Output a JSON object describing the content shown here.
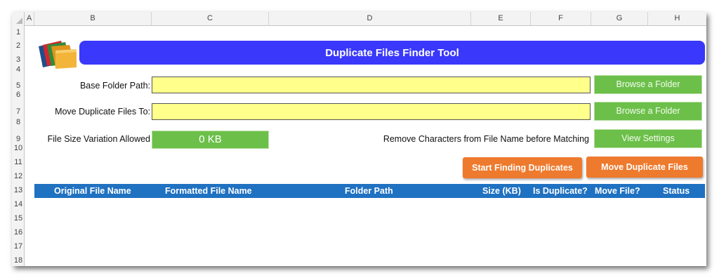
{
  "columns": [
    "A",
    "B",
    "C",
    "D",
    "E",
    "F",
    "G",
    "H"
  ],
  "rows": [
    "1",
    "2",
    "3",
    "4",
    "5",
    "6",
    "7",
    "8",
    "9",
    "10",
    "11",
    "12",
    "13",
    "14",
    "15",
    "16",
    "17",
    "18"
  ],
  "title": "Duplicate Files Finder Tool",
  "base_folder": {
    "label": "Base Folder Path:",
    "value": "",
    "button": "Browse a Folder"
  },
  "move_to": {
    "label": "Move Duplicate Files To:",
    "value": "",
    "button": "Browse a Folder"
  },
  "size_variation": {
    "label": "File Size Variation Allowed",
    "value": "0 KB"
  },
  "remove_chars": {
    "label": "Remove Characters from File Name before Matching",
    "button": "View Settings"
  },
  "actions": {
    "start": "Start Finding Duplicates",
    "move": "Move Duplicate Files"
  },
  "table_headers": [
    "Original File Name",
    "Formatted File Name",
    "Folder Path",
    "Size (KB)",
    "Is Duplicate?",
    "Move File?",
    "Status"
  ],
  "colors": {
    "title_bar": "#3a38fb",
    "input": "#ffff8c",
    "green": "#6cc04a",
    "orange": "#ee7a2d",
    "table_header": "#1f71c1"
  },
  "icons": {
    "logo": "folders-icon"
  }
}
